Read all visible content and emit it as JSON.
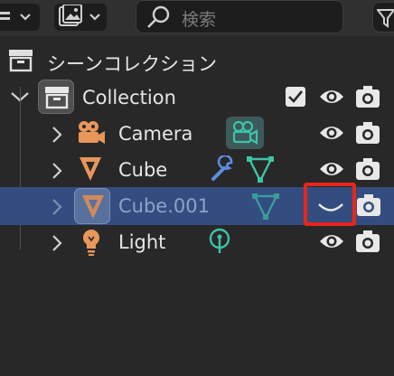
{
  "search": {
    "placeholder": "検索"
  },
  "outliner": {
    "scene_collection": {
      "label": "シーンコレクション",
      "icon": "scene-collection-icon"
    },
    "collection": {
      "label": "Collection",
      "checked": true,
      "icon": "collection-icon"
    },
    "objects": [
      {
        "label": "Camera",
        "icon": "camera-icon",
        "data_icon": "camera-data-icon",
        "selected": false,
        "visible": true
      },
      {
        "label": "Cube",
        "icon": "mesh-object-icon",
        "modifier_icon": "wrench-icon",
        "data_icon": "mesh-data-icon",
        "selected": false,
        "visible": true
      },
      {
        "label": "Cube.001",
        "icon": "mesh-object-icon",
        "data_icon": "mesh-data-icon",
        "selected": true,
        "visible": false
      },
      {
        "label": "Light",
        "icon": "light-icon",
        "data_icon": "light-data-icon",
        "selected": false,
        "visible": true
      }
    ]
  },
  "colors": {
    "background": "#282828",
    "selected_row": "#334d80",
    "object_orange": "#e8965a",
    "data_teal": "#3fc3a8",
    "highlight_red": "#e8261a"
  }
}
